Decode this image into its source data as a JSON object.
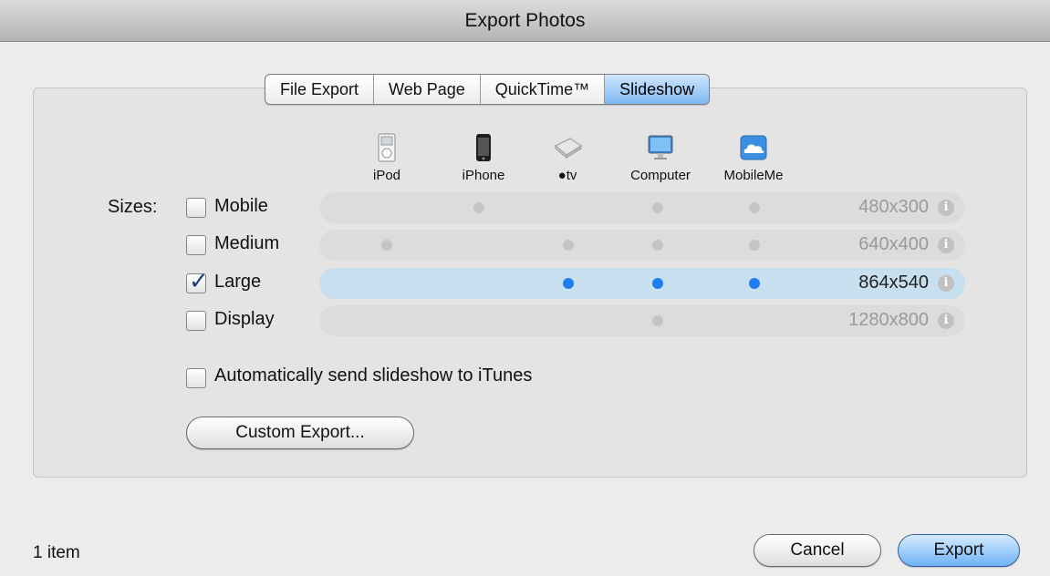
{
  "window": {
    "title": "Export Photos"
  },
  "tabs": [
    {
      "label": "File Export",
      "active": false
    },
    {
      "label": "Web Page",
      "active": false
    },
    {
      "label": "QuickTime™",
      "active": false
    },
    {
      "label": "Slideshow",
      "active": true
    }
  ],
  "devices": [
    {
      "label": "iPod",
      "icon": "ipod-icon"
    },
    {
      "label": "iPhone",
      "icon": "iphone-icon"
    },
    {
      "label": "tv",
      "icon": "appletv-icon"
    },
    {
      "label": "Computer",
      "icon": "computer-icon"
    },
    {
      "label": "MobileMe",
      "icon": "mobileme-icon"
    }
  ],
  "sizes": {
    "label": "Sizes:",
    "rows": [
      {
        "label": "Mobile",
        "checked": false,
        "resolution": "480x300",
        "devices": [
          "iPhone",
          "Computer",
          "MobileMe"
        ]
      },
      {
        "label": "Medium",
        "checked": false,
        "resolution": "640x400",
        "devices": [
          "iPod",
          "tv",
          "Computer",
          "MobileMe"
        ]
      },
      {
        "label": "Large",
        "checked": true,
        "resolution": "864x540",
        "devices": [
          "tv",
          "Computer",
          "MobileMe"
        ]
      },
      {
        "label": "Display",
        "checked": false,
        "resolution": "1280x800",
        "devices": [
          "Computer"
        ]
      }
    ]
  },
  "auto_send": {
    "label": "Automatically send slideshow to iTunes",
    "checked": false
  },
  "buttons": {
    "custom_export": "Custom Export...",
    "cancel": "Cancel",
    "export": "Export"
  },
  "status": {
    "text": "1 item"
  },
  "colors": {
    "accent": "#1f7cf1",
    "selected_row": "#c8dff0"
  }
}
